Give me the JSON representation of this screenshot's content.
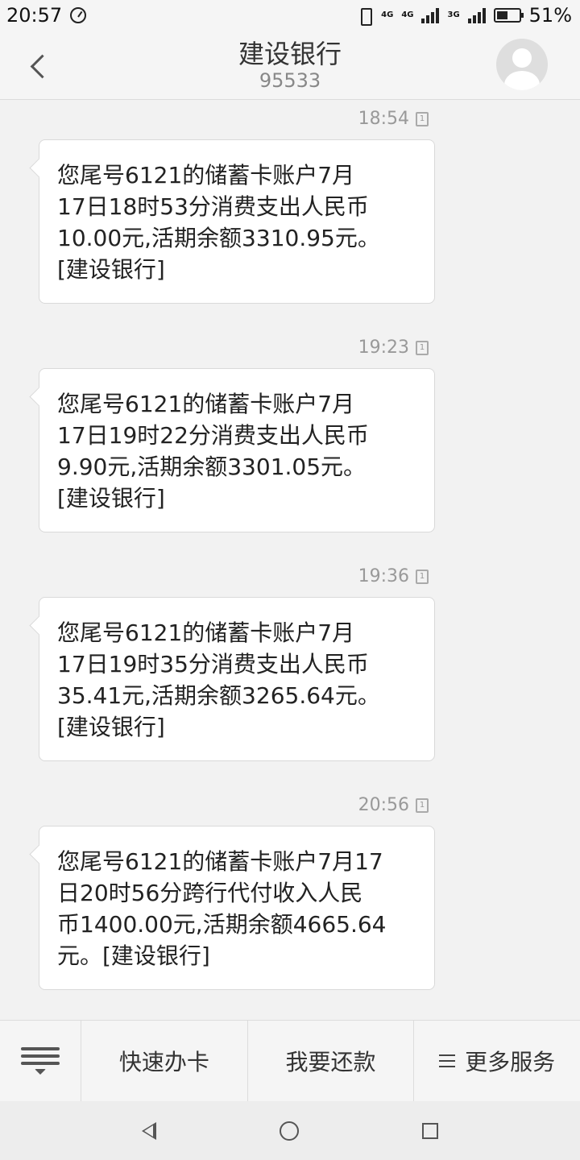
{
  "status_bar": {
    "time": "20:57",
    "net1": "4G",
    "net2": "4G",
    "net3": "3G",
    "battery_percent": "51%",
    "battery_level": 0.51
  },
  "header": {
    "title": "建设银行",
    "number": "95533"
  },
  "messages": [
    {
      "time": "18:54",
      "lines": [
        "您尾号6121的储蓄卡账户7月",
        "17日18时53分消费支出人民币",
        "10.00元,活期余额3310.95元。",
        "[建设银行]"
      ]
    },
    {
      "time": "19:23",
      "lines": [
        "您尾号6121的储蓄卡账户7月",
        "17日19时22分消费支出人民币",
        "9.90元,活期余额3301.05元。",
        "[建设银行]"
      ]
    },
    {
      "time": "19:36",
      "lines": [
        "您尾号6121的储蓄卡账户7月",
        "17日19时35分消费支出人民币",
        "35.41元,活期余额3265.64元。",
        "[建设银行]"
      ]
    },
    {
      "time": "20:56",
      "lines": [
        "您尾号6121的储蓄卡账户7月17",
        "日20时56分跨行代付收入人民",
        "币1400.00元,活期余额4665.64",
        "元。[建设银行]"
      ]
    }
  ],
  "sim_label": "1",
  "bottom_menu": {
    "item1": "快速办卡",
    "item2": "我要还款",
    "item3": "更多服务"
  },
  "icons": {
    "back": "chevron-left-icon",
    "avatar": "person-icon",
    "menu": "list-icon",
    "nav_back": "triangle-back-icon",
    "nav_home": "circle-home-icon",
    "nav_recent": "square-recent-icon"
  }
}
